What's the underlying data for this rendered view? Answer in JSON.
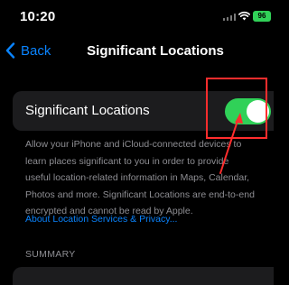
{
  "status_bar": {
    "time": "10:20",
    "signal_icon": "cellular-signal-icon",
    "wifi_icon": "wifi-icon",
    "battery_level": "96"
  },
  "nav": {
    "back_label": "Back",
    "title": "Significant Locations"
  },
  "settings": {
    "significant_locations_label": "Significant Locations",
    "significant_locations_enabled": true
  },
  "footer": {
    "description_line1": "Allow your iPhone and iCloud-connected devices to",
    "description_line2": "learn places significant to you in order to provide",
    "description_line3": "useful location-related information in Maps, Calendar,",
    "description_line4": "Photos and more. Significant Locations are end-to-end",
    "description_line5": "encrypted and cannot be read by Apple.",
    "link_label": "About Location Services & Privacy..."
  },
  "summary": {
    "header": "SUMMARY"
  },
  "colors": {
    "accent": "#0a84ff",
    "toggle_on": "#30d158",
    "annotation": "#ff2d2d",
    "battery": "#31d158"
  }
}
